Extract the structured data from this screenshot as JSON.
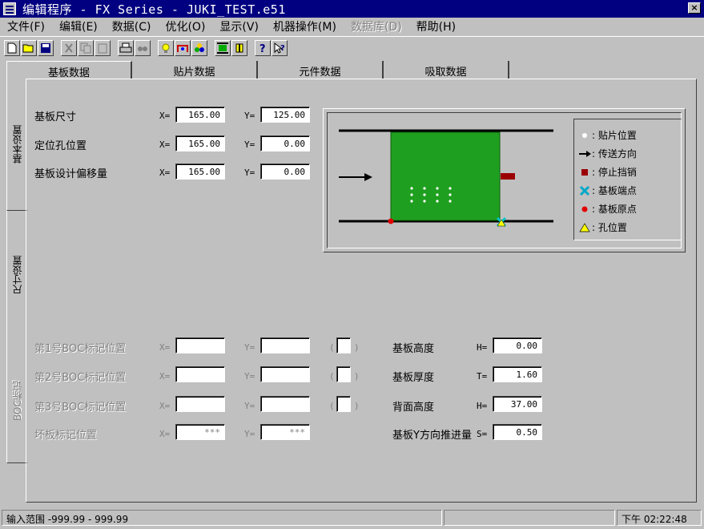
{
  "window": {
    "title": "编辑程序  - FX Series - JUKI_TEST.e51",
    "close_label": "×"
  },
  "menu": [
    {
      "label": "文件(F)",
      "enabled": true
    },
    {
      "label": "编辑(E)",
      "enabled": true
    },
    {
      "label": "数据(C)",
      "enabled": true
    },
    {
      "label": "优化(O)",
      "enabled": true
    },
    {
      "label": "显示(V)",
      "enabled": true
    },
    {
      "label": "机器操作(M)",
      "enabled": true
    },
    {
      "label": "数据库(D)",
      "enabled": false
    },
    {
      "label": "帮助(H)",
      "enabled": true
    }
  ],
  "toolbar": {
    "buttons": [
      "new-file-icon",
      "open-folder-icon",
      "save-icon",
      "cut-icon",
      "copy-icon",
      "paste-icon",
      "print-icon",
      "binoculars-icon",
      "lightbulb-icon",
      "optimize-icon",
      "parts-icon",
      "board-size-icon",
      "board-offset-icon",
      "help-icon",
      "context-help-icon"
    ]
  },
  "top_tabs": [
    "基板数据",
    "贴片数据",
    "元件数据",
    "吸取数据"
  ],
  "side_tabs": [
    "基本设置",
    "尺寸设置",
    "BOC标记"
  ],
  "board": {
    "rows": [
      {
        "label": "基板尺寸",
        "x_prefix": "X=",
        "x": "165.00",
        "y_prefix": "Y=",
        "y": "125.00"
      },
      {
        "label": "定位孔位置",
        "x_prefix": "X=",
        "x": "165.00",
        "y_prefix": "Y=",
        "y": "0.00"
      },
      {
        "label": "基板设计偏移量",
        "x_prefix": "X=",
        "x": "165.00",
        "y_prefix": "Y=",
        "y": "0.00"
      }
    ]
  },
  "legend": [
    {
      "icon": "white-dot-icon",
      "label": ": 贴片位置"
    },
    {
      "icon": "arrow-right-icon",
      "label": ": 传送方向"
    },
    {
      "icon": "red-square-icon",
      "label": ": 停止挡销"
    },
    {
      "icon": "cyan-x-icon",
      "label": ": 基板端点"
    },
    {
      "icon": "red-dot-icon",
      "label": ": 基板原点"
    },
    {
      "icon": "yellow-triangle-icon",
      "label": ": 孔位置"
    }
  ],
  "boc": {
    "rows": [
      {
        "label": "第1号BOC标记位置",
        "x_prefix": "X=",
        "x": "",
        "y_prefix": "Y=",
        "y": "",
        "paren_open": "(",
        "paren_close": ")"
      },
      {
        "label": "第2号BOC标记位置",
        "x_prefix": "X=",
        "x": "",
        "y_prefix": "Y=",
        "y": "",
        "paren_open": "(",
        "paren_close": ")"
      },
      {
        "label": "第3号BOC标记位置",
        "x_prefix": "X=",
        "x": "",
        "y_prefix": "Y=",
        "y": "",
        "paren_open": "(",
        "paren_close": ")"
      },
      {
        "label": "坏板标记位置",
        "x_prefix": "X=",
        "x": "***",
        "y_prefix": "Y=",
        "y": "***"
      }
    ]
  },
  "heights": {
    "rows": [
      {
        "label": "基板高度",
        "prefix": "H=",
        "value": "0.00"
      },
      {
        "label": "基板厚度",
        "prefix": "T=",
        "value": "1.60"
      },
      {
        "label": "背面高度",
        "prefix": "H=",
        "value": "37.00"
      },
      {
        "label": "基板Y方向推进量",
        "prefix": "S=",
        "value": "0.50"
      }
    ]
  },
  "status": {
    "range": "输入范围  -999.99 - 999.99",
    "time": "下午 02:22:48"
  },
  "colors": {
    "board_green": "#1f9f1f",
    "title_blue": "#000080",
    "stopper_red": "#9b0000"
  }
}
